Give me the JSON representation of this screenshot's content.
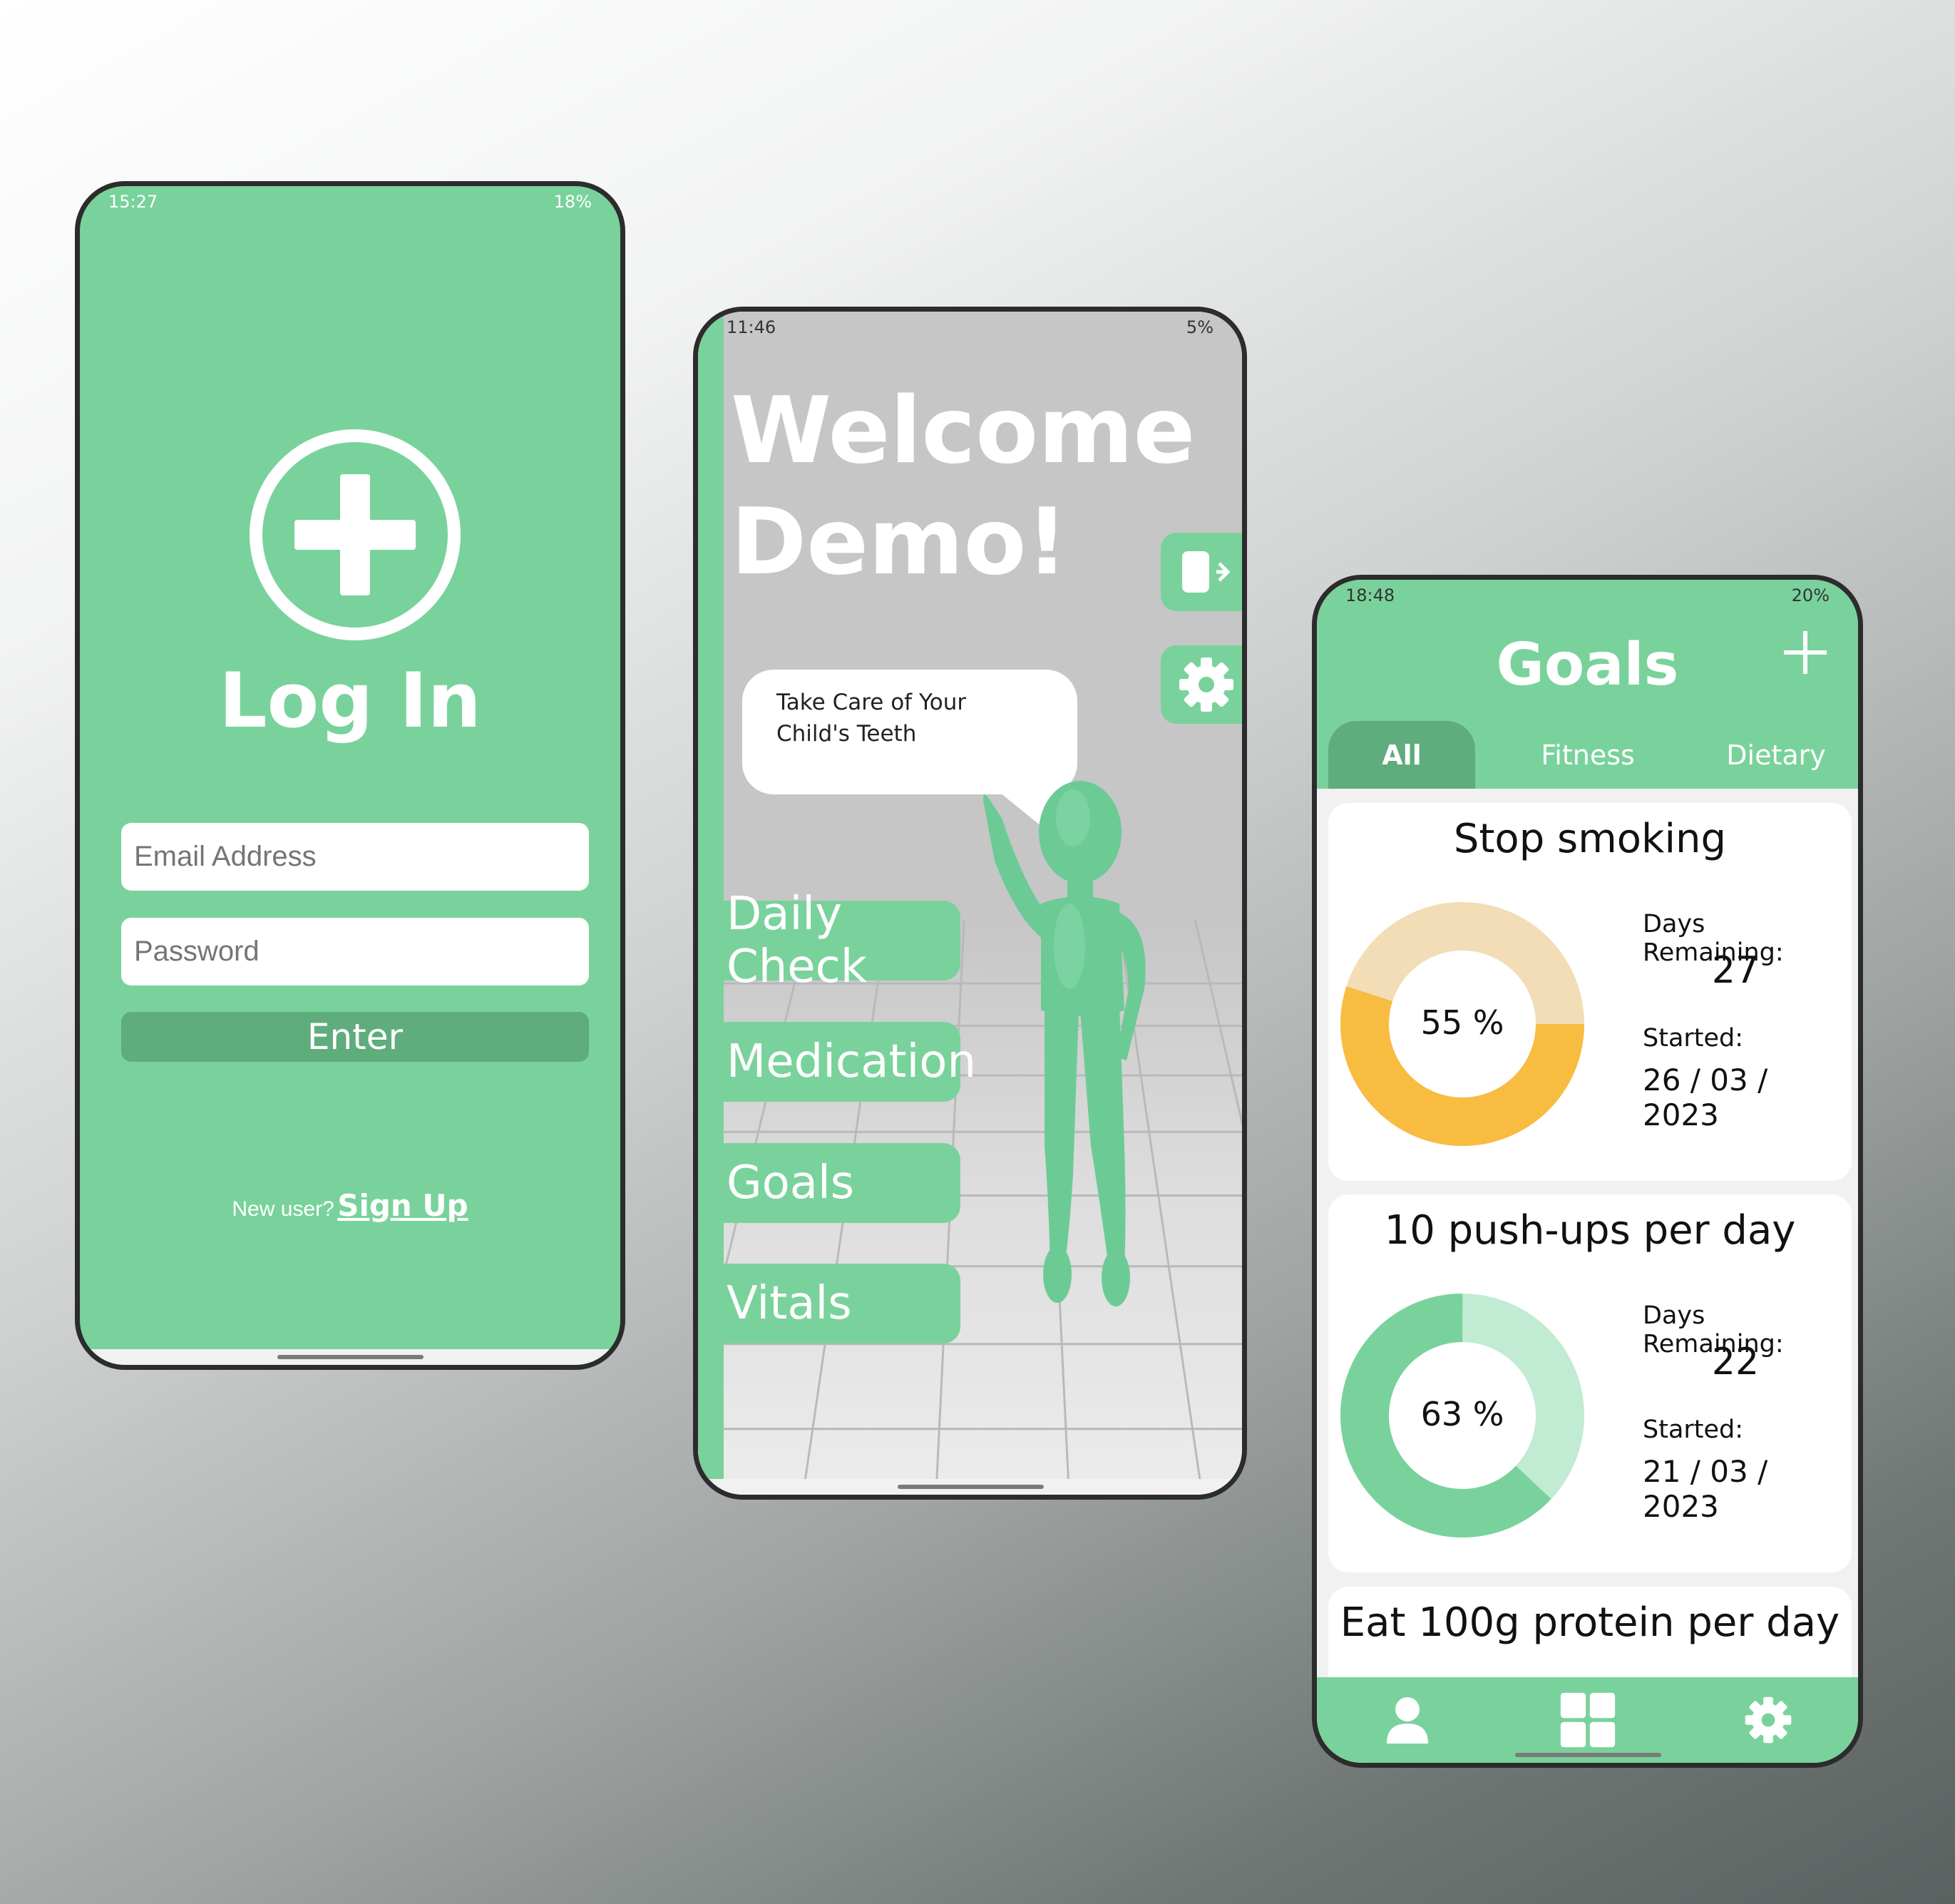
{
  "colors": {
    "brand": "#79d29b",
    "brand_dark": "#5fac7d",
    "smoking_ring": "#f8bc41",
    "smoking_track": "#f2ddb6",
    "pushup_track": "#c1ebd3"
  },
  "login": {
    "status": {
      "time": "15:27",
      "right": "18%"
    },
    "title": "Log In",
    "email_placeholder": "Email Address",
    "password_placeholder": "Password",
    "enter_label": "Enter",
    "new_user": "New user?",
    "signup_link": "Sign Up"
  },
  "home": {
    "status": {
      "time": "11:46",
      "right": "5%"
    },
    "welcome_line1": "Welcome",
    "welcome_line2": "Demo!",
    "speech": "Take Care of Your Child's Teeth",
    "menu": [
      "Daily Check",
      "Medication",
      "Goals",
      "Vitals"
    ]
  },
  "goals": {
    "status": {
      "time": "18:48",
      "right": "20%"
    },
    "title": "Goals",
    "tabs": [
      "All",
      "Fitness",
      "Dietary"
    ],
    "active_tab": "All",
    "cards": [
      {
        "title": "Stop smoking",
        "percent": 55,
        "percent_label": "55 %",
        "days_label": "Days Remaining:",
        "days": "27",
        "started_label": "Started:",
        "started": "26 / 03 / 2023"
      },
      {
        "title": "10 push-ups per day",
        "percent": 63,
        "percent_label": "63 %",
        "days_label": "Days Remaining:",
        "days": "22",
        "started_label": "Started:",
        "started": "21 / 03 / 2023"
      },
      {
        "title": "Eat 100g protein per day"
      }
    ],
    "nav": [
      "person-icon",
      "grid-icon",
      "gear-icon"
    ]
  }
}
